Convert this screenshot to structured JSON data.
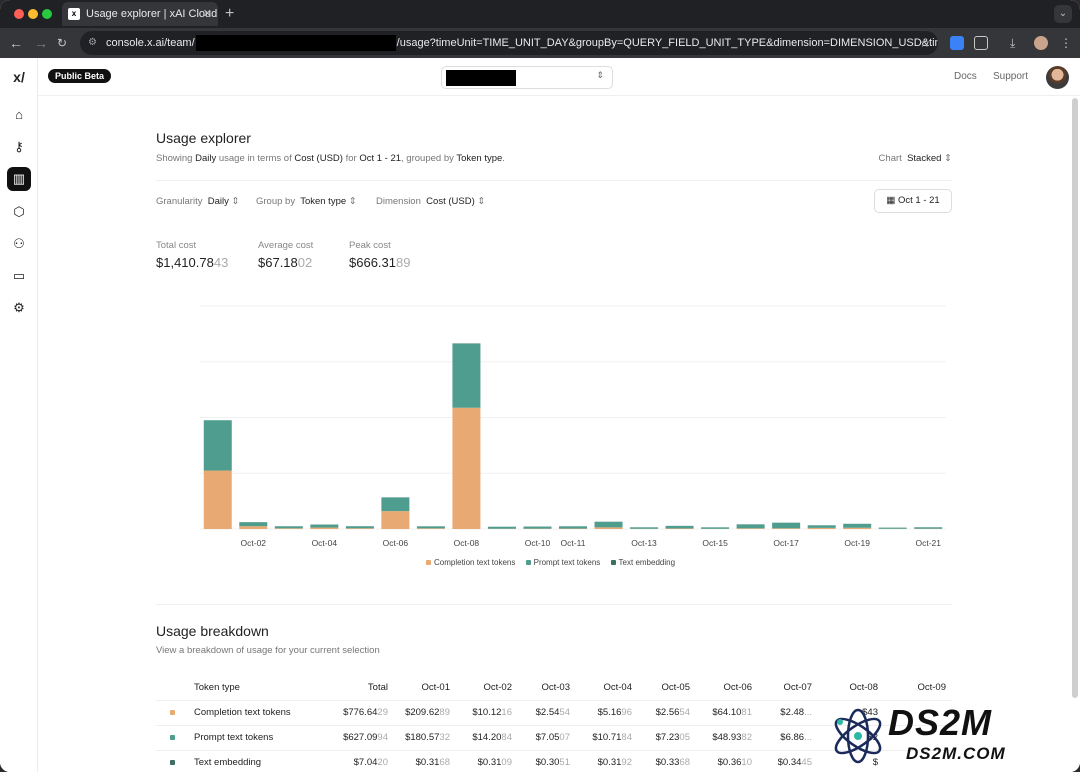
{
  "browser": {
    "tab_title": "Usage explorer | xAI Cloud Co",
    "url_prefix": "console.x.ai/team/",
    "url_suffix": "/usage?timeUnit=TIME_UNIT_DAY&groupBy=QUERY_FIELD_UNIT_TYPE&dimension=DIMENSION_USD&timezone=..."
  },
  "header": {
    "badge": "Public Beta",
    "docs": "Docs",
    "support": "Support"
  },
  "page": {
    "title": "Usage explorer",
    "subtitle": {
      "p1": "Showing ",
      "granularity": "Daily",
      "p2": " usage in terms of ",
      "dimension": "Cost (USD)",
      "p3": " for ",
      "range": "Oct 1 - 21",
      "p4": ", grouped by ",
      "group": "Token type",
      "p5": "."
    },
    "chart_mode": {
      "label": "Chart",
      "value": "Stacked"
    },
    "filters": {
      "granularity_label": "Granularity",
      "granularity_value": "Daily",
      "group_label": "Group by",
      "group_value": "Token type",
      "dimension_label": "Dimension",
      "dimension_value": "Cost (USD)",
      "date_range": "Oct 1 - 21"
    },
    "stats": [
      {
        "label": "Total cost",
        "main": "$1,410.78",
        "faint": "43"
      },
      {
        "label": "Average cost",
        "main": "$67.18",
        "faint": "02"
      },
      {
        "label": "Peak cost",
        "main": "$666.31",
        "faint": "89"
      }
    ]
  },
  "chart_data": {
    "type": "bar",
    "stacked": true,
    "categories": [
      "Oct-01",
      "Oct-02",
      "Oct-03",
      "Oct-04",
      "Oct-05",
      "Oct-06",
      "Oct-07",
      "Oct-08",
      "Oct-09",
      "Oct-10",
      "Oct-11",
      "Oct-12",
      "Oct-13",
      "Oct-14",
      "Oct-15",
      "Oct-16",
      "Oct-17",
      "Oct-18",
      "Oct-19",
      "Oct-20",
      "Oct-21"
    ],
    "tick_labels": [
      "",
      "Oct-02",
      "",
      "Oct-04",
      "",
      "Oct-06",
      "",
      "Oct-08",
      "",
      "Oct-10",
      "Oct-11",
      "",
      "Oct-13",
      "",
      "Oct-15",
      "",
      "Oct-17",
      "",
      "Oct-19",
      "",
      "Oct-21"
    ],
    "series": [
      {
        "name": "Completion text tokens",
        "color": "#e8a972",
        "values": [
          209.63,
          10.12,
          2.55,
          5.17,
          2.57,
          64.11,
          2.48,
          435.0,
          1.0,
          1.2,
          1.5,
          6.0,
          0.8,
          2.0,
          0.7,
          2.5,
          2.5,
          4.0,
          4.5,
          0.8,
          1.0
        ]
      },
      {
        "name": "Prompt text tokens",
        "color": "#4e9d8e",
        "values": [
          180.57,
          14.21,
          7.05,
          10.72,
          7.23,
          48.94,
          6.86,
          230.0,
          7.0,
          7.5,
          8.0,
          20.0,
          5.0,
          9.0,
          5.0,
          14.0,
          20.0,
          9.0,
          14.0,
          4.0,
          5.0
        ]
      },
      {
        "name": "Text embedding",
        "color": "#3f6e63",
        "values": [
          0.0,
          0.31,
          0.31,
          0.31,
          0.33,
          0.36,
          0.34,
          1.0,
          0.3,
          0.3,
          0.3,
          0.3,
          0.3,
          0.3,
          0.3,
          0.3,
          0.3,
          0.3,
          0.3,
          0.3,
          0.3
        ]
      }
    ],
    "ylim": [
      0,
      800
    ],
    "grid": true,
    "legend": "bottom"
  },
  "breakdown": {
    "title": "Usage breakdown",
    "subtitle": "View a breakdown of usage for your current selection",
    "headers": [
      "Token type",
      "Total",
      "Oct-01",
      "Oct-02",
      "Oct-03",
      "Oct-04",
      "Oct-05",
      "Oct-06",
      "Oct-07",
      "Oct-08",
      "Oct-09"
    ],
    "rows": [
      {
        "color": "#e8a972",
        "name": "Completion text tokens",
        "cells": [
          [
            "$776.64",
            "29"
          ],
          [
            "$209.62",
            "89"
          ],
          [
            "$10.12",
            "16"
          ],
          [
            "$2.54",
            "54"
          ],
          [
            "$5.16",
            "96"
          ],
          [
            "$2.56",
            "54"
          ],
          [
            "$64.10",
            "81"
          ],
          [
            "$2.48",
            "..."
          ],
          [
            "$43",
            ""
          ],
          [
            "",
            ""
          ]
        ]
      },
      {
        "color": "#4e9d8e",
        "name": "Prompt text tokens",
        "cells": [
          [
            "$627.09",
            "94"
          ],
          [
            "$180.57",
            "32"
          ],
          [
            "$14.20",
            "84"
          ],
          [
            "$7.05",
            "07"
          ],
          [
            "$10.71",
            "84"
          ],
          [
            "$7.23",
            "05"
          ],
          [
            "$48.93",
            "82"
          ],
          [
            "$6.86",
            "..."
          ],
          [
            "$2",
            ""
          ],
          [
            "",
            ""
          ]
        ]
      },
      {
        "color": "#3f6e63",
        "name": "Text embedding",
        "cells": [
          [
            "$7.04",
            "20"
          ],
          [
            "$0.31",
            "68"
          ],
          [
            "$0.31",
            "09"
          ],
          [
            "$0.30",
            "51"
          ],
          [
            "$0.31",
            "92"
          ],
          [
            "$0.33",
            "68"
          ],
          [
            "$0.36",
            "10"
          ],
          [
            "$0.34",
            "45"
          ],
          [
            "$",
            ""
          ],
          [
            "",
            ""
          ]
        ]
      }
    ]
  },
  "watermark": {
    "logo": "DS2M",
    "site": "DS2M.COM"
  }
}
